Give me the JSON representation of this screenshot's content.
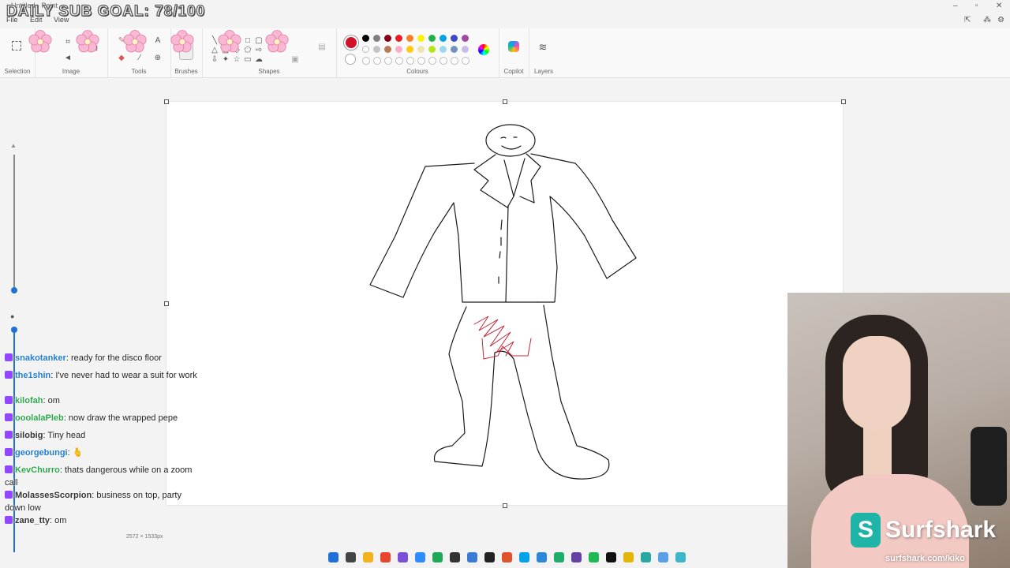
{
  "titlebar": {
    "title": "Untitled - Paint",
    "menu": [
      "File",
      "Edit",
      "View"
    ]
  },
  "overlay_goal": "DAILY SUB GOAL: 78/100",
  "ribbon": {
    "groups": [
      "Selection",
      "Image",
      "Tools",
      "Brushes",
      "Shapes",
      "Colours",
      "Copilot",
      "Layers"
    ]
  },
  "colours": {
    "primary": "#d2112b",
    "row1": [
      "#000000",
      "#7f7f7f",
      "#880015",
      "#ed1c24",
      "#ff7f27",
      "#fff200",
      "#22b14c",
      "#00a2e8",
      "#3f48cc",
      "#a349a4"
    ],
    "row2": [
      "#ffffff",
      "#c3c3c3",
      "#b97a57",
      "#ffaec9",
      "#ffc90e",
      "#efe4b0",
      "#b5e61d",
      "#99d9ea",
      "#7092be",
      "#c8bfe7"
    ]
  },
  "canvas": {
    "size_label": "2572 × 1533px"
  },
  "chat": [
    {
      "user": "snakotanker",
      "color": "#1e7bd6",
      "text": "ready for the disco floor"
    },
    {
      "user": "the1shin",
      "color": "#1e7bd6",
      "text": "I've never had to wear a suit for work"
    },
    {
      "user": "kilofah",
      "color": "#2aa84a",
      "text": "om"
    },
    {
      "user": "ooolalaPleb",
      "color": "#2aa84a",
      "text": "now draw the wrapped pepe"
    },
    {
      "user": "silobig",
      "color": "#333333",
      "text": "Tiny head"
    },
    {
      "user": "georgebungi",
      "color": "#1e7bd6",
      "text": "🫰"
    },
    {
      "user": "KevChurro",
      "color": "#2aa84a",
      "text": "thats dangerous while on a zoom call"
    },
    {
      "user": "MolassesScorpion",
      "color": "#333333",
      "text": "business on top, party down low"
    },
    {
      "user": "zane_tty",
      "color": "#333333",
      "text": "om"
    }
  ],
  "sponsor": {
    "name": "Surfshark",
    "url": "surfshark.com/kiko",
    "color": "#1fb4a8"
  }
}
